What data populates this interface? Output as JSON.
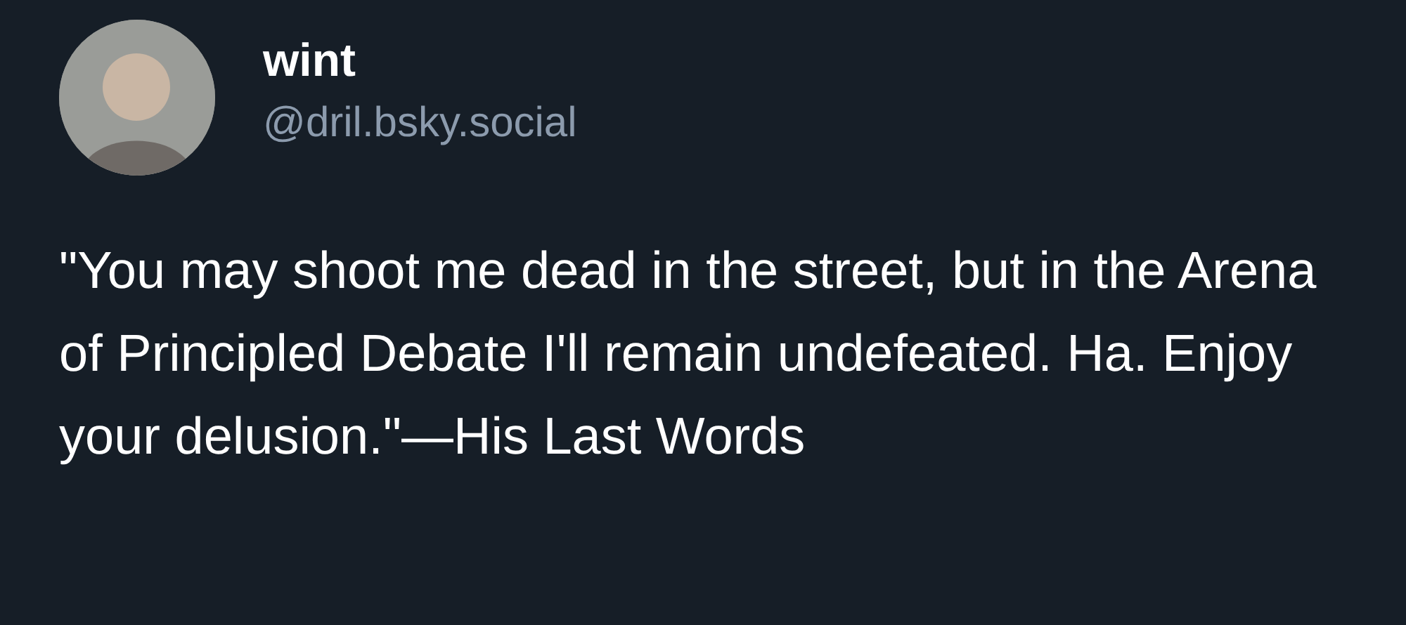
{
  "post": {
    "author": {
      "display_name": "wint",
      "handle": "@dril.bsky.social"
    },
    "text": "\"You may shoot me dead in the street, but in the Arena of Principled Debate I'll remain undefeated. Ha. Enjoy your delusion.\"—His Last Words"
  }
}
